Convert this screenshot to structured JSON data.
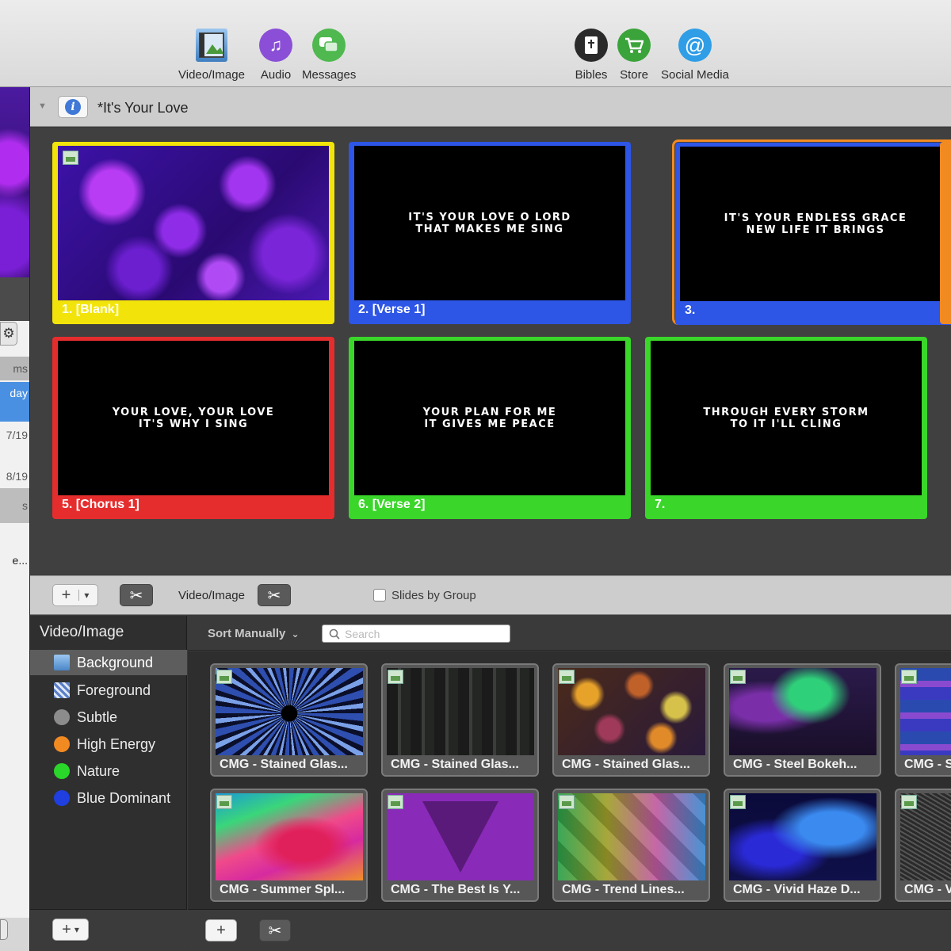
{
  "toolbar": {
    "buttons": [
      {
        "label": "Video/Image",
        "icon": "video-image-icon",
        "color": "#5b8fc7"
      },
      {
        "label": "Audio",
        "icon": "music-note-icon",
        "color": "#8a4fd6"
      },
      {
        "label": "Messages",
        "icon": "speech-bubbles-icon",
        "color": "#4fb84f"
      },
      {
        "label": "Bibles",
        "icon": "bible-icon",
        "color": "#2a2a2a"
      },
      {
        "label": "Store",
        "icon": "shopping-cart-icon",
        "color": "#3aa33a"
      },
      {
        "label": "Social Media",
        "icon": "at-sign-icon",
        "color": "#2f9ee6"
      }
    ]
  },
  "left_strip": {
    "rows": [
      "ms",
      "day",
      "7/19",
      "8/19",
      "s",
      "e..."
    ]
  },
  "document": {
    "title": "*It's Your Love"
  },
  "slides": [
    {
      "label": "1. [Blank]",
      "text": "",
      "color": "#f2e40a"
    },
    {
      "label": "2. [Verse 1]",
      "text": "IT'S YOUR LOVE O LORD\nTHAT MAKES ME SING",
      "color": "#2d55e6"
    },
    {
      "label": "3.",
      "text": "IT'S YOUR ENDLESS GRACE\nNEW LIFE IT BRINGS",
      "color": "#2d55e6"
    },
    {
      "label": "5. [Chorus 1]",
      "text": "YOUR LOVE, YOUR LOVE\nIT'S WHY I SING",
      "color": "#e62d2d"
    },
    {
      "label": "6. [Verse 2]",
      "text": "YOUR PLAN FOR ME\nIT GIVES ME PEACE",
      "color": "#3ad62a"
    },
    {
      "label": "7.",
      "text": "THROUGH EVERY STORM\nTO IT I'LL CLING",
      "color": "#3ad62a"
    }
  ],
  "slide_bar": {
    "add": "+",
    "dropdown": "▾",
    "scissors": "✂",
    "video_image_label": "Video/Image",
    "slides_by_group_label": "Slides by Group"
  },
  "media_sidebar": {
    "title": "Video/Image",
    "categories": [
      {
        "label": "Background",
        "icon": "image-icon",
        "color": "#6a9bd6"
      },
      {
        "label": "Foreground",
        "icon": "clapperboard-icon",
        "color": "#5b7ec7"
      },
      {
        "label": "Subtle",
        "icon": "grey-dot-icon",
        "color": "#8c8c8c"
      },
      {
        "label": "High Energy",
        "icon": "orange-dot-icon",
        "color": "#f28a22"
      },
      {
        "label": "Nature",
        "icon": "green-dot-icon",
        "color": "#2ad62a"
      },
      {
        "label": "Blue Dominant",
        "icon": "blue-dot-icon",
        "color": "#1f3fe0"
      }
    ],
    "add": "+",
    "dropdown": "▾"
  },
  "media": {
    "sort_label": "Sort Manually",
    "sort_arrow": "⌄",
    "search_placeholder": "Search",
    "items": [
      {
        "label": "CMG - Stained Glas..."
      },
      {
        "label": "CMG - Stained Glas..."
      },
      {
        "label": "CMG - Stained Glas..."
      },
      {
        "label": "CMG - Steel Bokeh..."
      },
      {
        "label": "CMG - S"
      },
      {
        "label": "CMG - Summer Spl..."
      },
      {
        "label": "CMG - The Best Is Y..."
      },
      {
        "label": "CMG - Trend Lines..."
      },
      {
        "label": "CMG - Vivid Haze D..."
      },
      {
        "label": "CMG - V"
      }
    ],
    "add": "+",
    "scissors": "✂"
  }
}
